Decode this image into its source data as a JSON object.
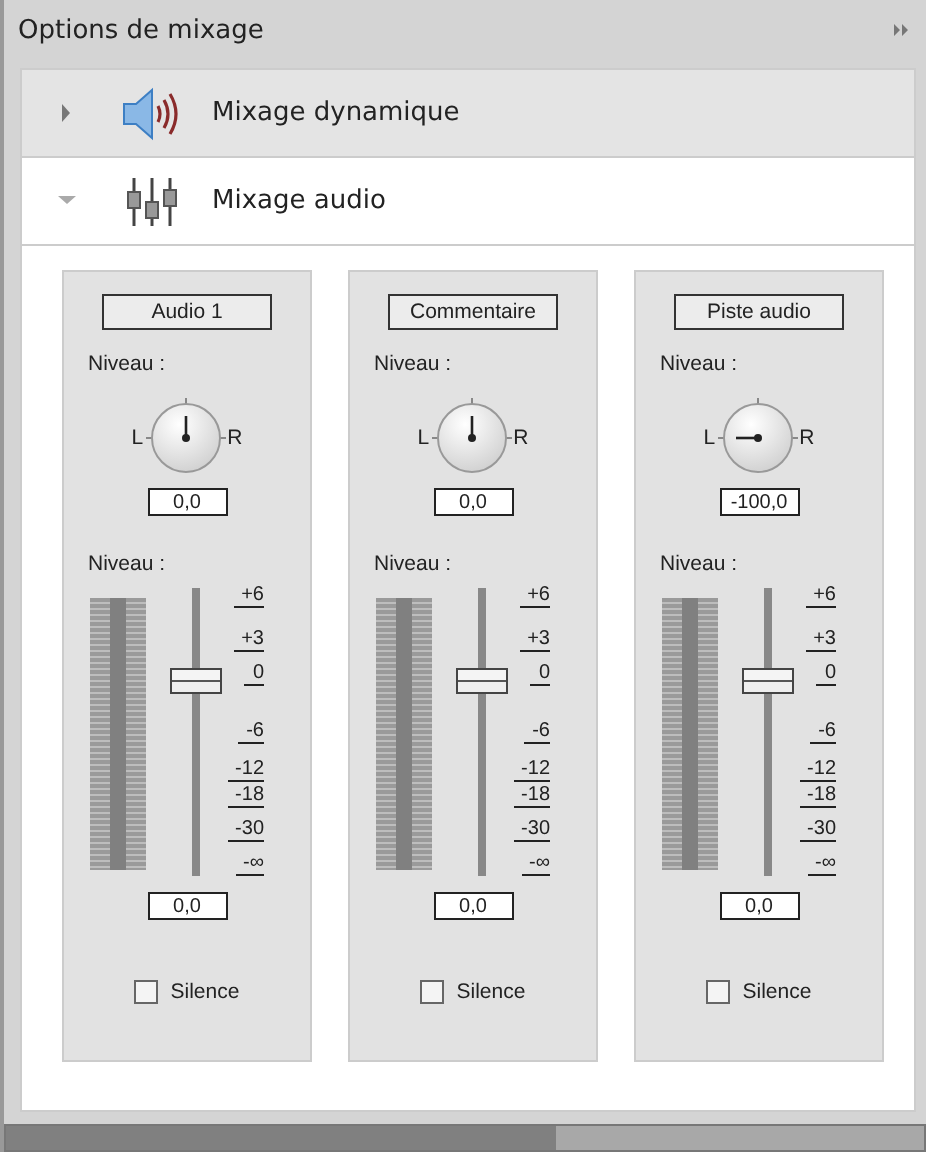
{
  "panel": {
    "title": "Options de mixage"
  },
  "sections": [
    {
      "kind": "speaker",
      "label": "Mixage dynamique",
      "expanded": false
    },
    {
      "kind": "sliders",
      "label": "Mixage audio",
      "expanded": true
    }
  ],
  "channels": [
    {
      "name": "Audio 1",
      "pan_label": "Niveau :",
      "pan": {
        "left": "L",
        "right": "R",
        "value": "0,0"
      },
      "fader_label": "Niveau :",
      "fader": {
        "level": 0.68,
        "value": "0,0"
      },
      "scale": [
        "+6",
        "+3",
        "0",
        "-6",
        "-12",
        "-18",
        "-30",
        "-∞"
      ],
      "mute": {
        "label": "Silence",
        "checked": false
      }
    },
    {
      "name": "Commentaire",
      "pan_label": "Niveau :",
      "pan": {
        "left": "L",
        "right": "R",
        "value": "0,0"
      },
      "fader_label": "Niveau :",
      "fader": {
        "level": 0.68,
        "value": "0,0"
      },
      "scale": [
        "+6",
        "+3",
        "0",
        "-6",
        "-12",
        "-18",
        "-30",
        "-∞"
      ],
      "mute": {
        "label": "Silence",
        "checked": false
      }
    },
    {
      "name": "Piste audio",
      "pan_label": "Niveau :",
      "pan": {
        "left": "L",
        "right": "R",
        "value": "-100,0"
      },
      "fader_label": "Niveau :",
      "fader": {
        "level": 0.68,
        "value": "0,0"
      },
      "scale": [
        "+6",
        "+3",
        "0",
        "-6",
        "-12",
        "-18",
        "-30",
        "-∞"
      ],
      "mute": {
        "label": "Silence",
        "checked": false
      }
    }
  ]
}
